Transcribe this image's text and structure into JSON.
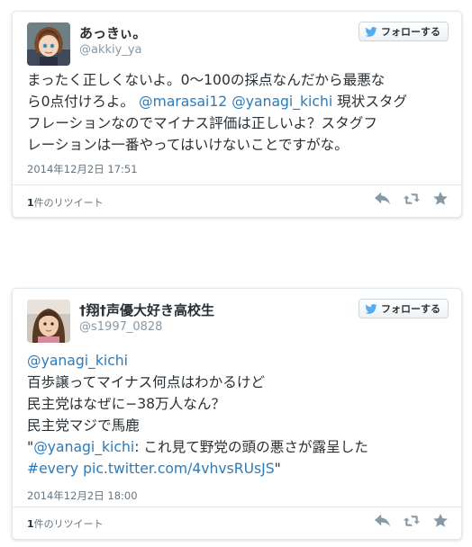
{
  "tweets": [
    {
      "name": "あっきぃ。",
      "handle": "@akkiy_ya",
      "follow_label": "フォローする",
      "lines": [
        [
          {
            "t": "まったく正しくないよ。0〜100の採点なんだから最悪な"
          }
        ],
        [
          {
            "t": "ら0点付けろよ。 "
          },
          {
            "t": "@marasai12",
            "link": true
          },
          {
            "t": " "
          },
          {
            "t": "@yanagi_kichi",
            "link": true
          },
          {
            "t": " 現状スタグ"
          }
        ],
        [
          {
            "t": "フレーションなのでマイナス評価は正しいよ？スタグフ"
          }
        ],
        [
          {
            "t": "レーションは一番やってはいけないことですがな。"
          }
        ]
      ],
      "date": "2014年12月2日 17:51",
      "retweets_count": "1",
      "retweets_suffix": "件のリツイート"
    },
    {
      "name": "†翔†声優大好き高校生",
      "handle": "@s1997_0828",
      "follow_label": "フォローする",
      "lines": [
        [
          {
            "t": "@yanagi_kichi",
            "link": true
          }
        ],
        [
          {
            "t": "百歩譲ってマイナス何点はわかるけど"
          }
        ],
        [
          {
            "t": "民主党はなぜに−38万人なん？"
          }
        ],
        [
          {
            "t": "民主党マジで馬鹿"
          }
        ],
        [
          {
            "t": "\""
          },
          {
            "t": "@yanagi_kichi",
            "link": true
          },
          {
            "t": ": これ見て野党の頭の悪さが露呈した"
          }
        ],
        [
          {
            "t": " "
          },
          {
            "t": "#every",
            "link": true
          },
          {
            "t": " "
          },
          {
            "t": "pic.twitter.com/4vhvsRUsJS",
            "link": true
          },
          {
            "t": "\""
          }
        ]
      ],
      "date": "2014年12月2日 18:00",
      "retweets_count": "1",
      "retweets_suffix": "件のリツイート"
    }
  ],
  "icons": {
    "follow": "twitter-bird-icon",
    "reply": "reply-icon",
    "retweet": "retweet-icon",
    "favorite": "star-icon"
  },
  "colors": {
    "link": "#2b7bb9",
    "muted": "#66757f",
    "border": "#e1e8ed",
    "twitter_blue": "#55acee"
  }
}
